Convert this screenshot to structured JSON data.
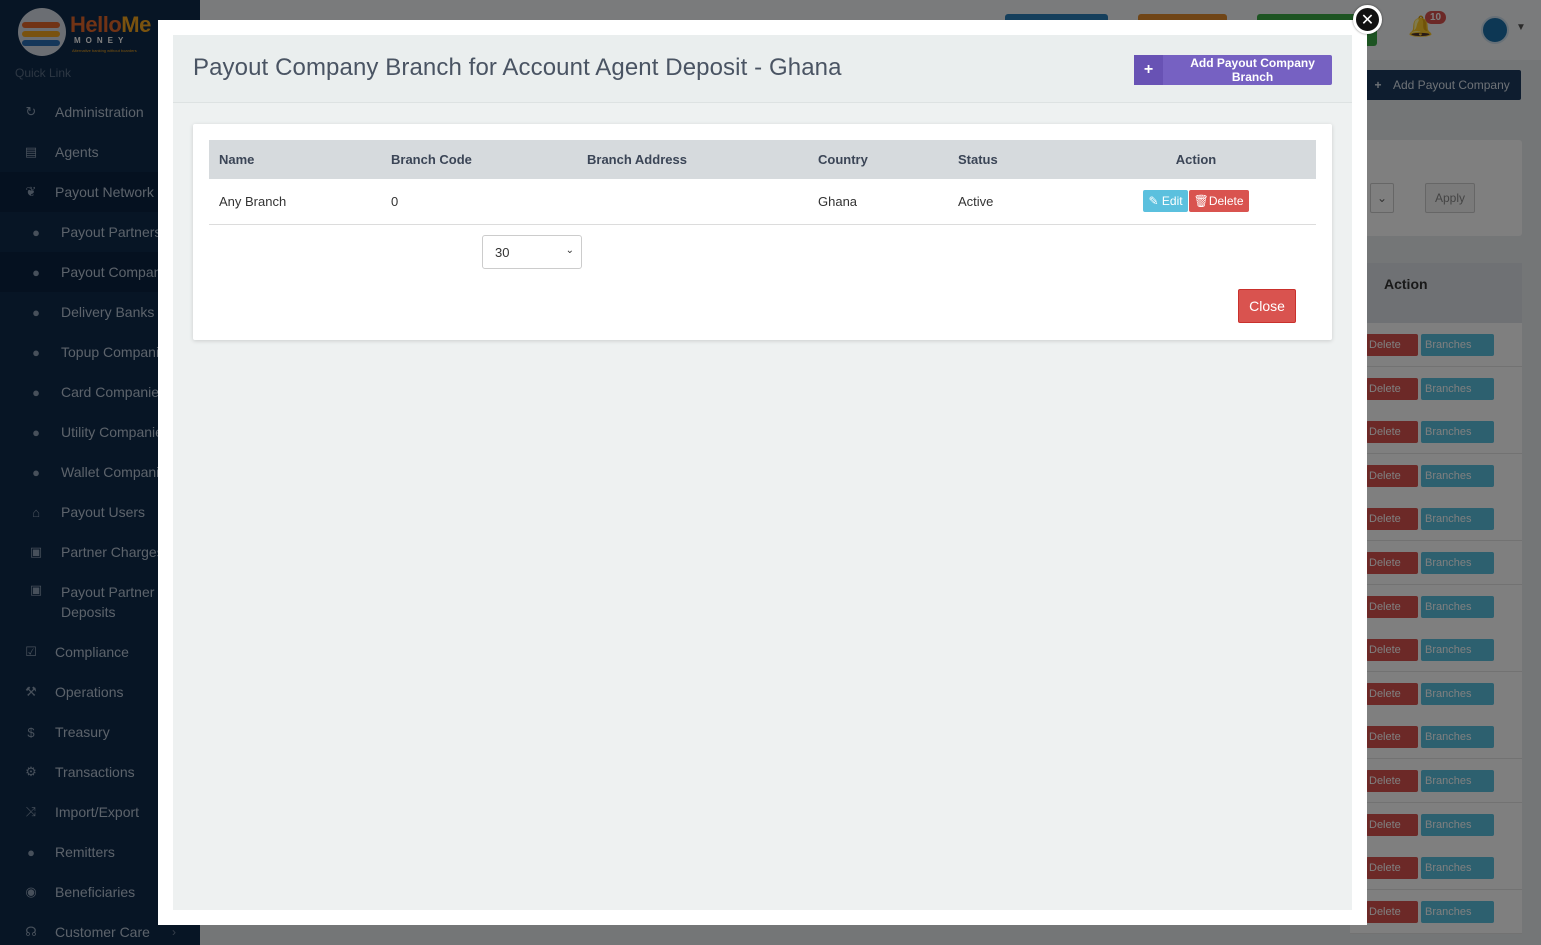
{
  "app": {
    "logo_text_a": "Hello",
    "logo_text_b": "Me",
    "logo_sub": "MONEY",
    "logo_tagline": "Alternative banking without boarders",
    "quick_link": "Quick Link",
    "notifications_count": "10"
  },
  "sidebar": {
    "items": [
      {
        "label": "Administration",
        "icon": "sync-icon"
      },
      {
        "label": "Agents",
        "icon": "building-icon"
      },
      {
        "label": "Payout Network",
        "icon": "handshake-icon"
      },
      {
        "label": "Payout Partners",
        "icon": "user-icon"
      },
      {
        "label": "Payout Companies",
        "icon": "user-icon"
      },
      {
        "label": "Delivery Banks",
        "icon": "user-icon"
      },
      {
        "label": "Topup Companies",
        "icon": "user-icon"
      },
      {
        "label": "Card Companies",
        "icon": "user-icon"
      },
      {
        "label": "Utility Companies",
        "icon": "user-icon"
      },
      {
        "label": "Wallet Companies",
        "icon": "user-icon"
      },
      {
        "label": "Payout Users",
        "icon": "bank-icon"
      },
      {
        "label": "Partner Charges",
        "icon": "money-icon"
      },
      {
        "label": "Payout Partner Deposits",
        "icon": "money-icon"
      },
      {
        "label": "Compliance",
        "icon": "check-square-icon"
      },
      {
        "label": "Operations",
        "icon": "wrench-icon"
      },
      {
        "label": "Treasury",
        "icon": "dollar-icon"
      },
      {
        "label": "Transactions",
        "icon": "cogs-icon"
      },
      {
        "label": "Import/Export",
        "icon": "shuffle-icon"
      },
      {
        "label": "Remitters",
        "icon": "users-icon"
      },
      {
        "label": "Beneficiaries",
        "icon": "user-circle-icon"
      },
      {
        "label": "Customer Care",
        "icon": "headset-icon"
      }
    ]
  },
  "background": {
    "add_company_label": "Add Payout Company",
    "apply_label": "Apply",
    "action_header": "Action",
    "row_delete_label": "Delete",
    "row_branches_label": "Branches"
  },
  "modal": {
    "title": "Payout Company Branch for Account Agent Deposit - Ghana",
    "add_branch_label": "Add Payout Company Branch",
    "columns": [
      "Name",
      "Branch Code",
      "Branch Address",
      "Country",
      "Status",
      "Action"
    ],
    "rows": [
      {
        "name": "Any Branch",
        "branch_code": "0",
        "branch_address": "",
        "country": "Ghana",
        "status": "Active"
      }
    ],
    "edit_label": "Edit",
    "delete_label": "Delete",
    "page_size": "30",
    "close_label": "Close"
  },
  "colors": {
    "sidebar_bg": "#0f2a4a",
    "accent_purple": "#7661c2",
    "danger": "#d9534f",
    "info": "#5bc0de"
  }
}
